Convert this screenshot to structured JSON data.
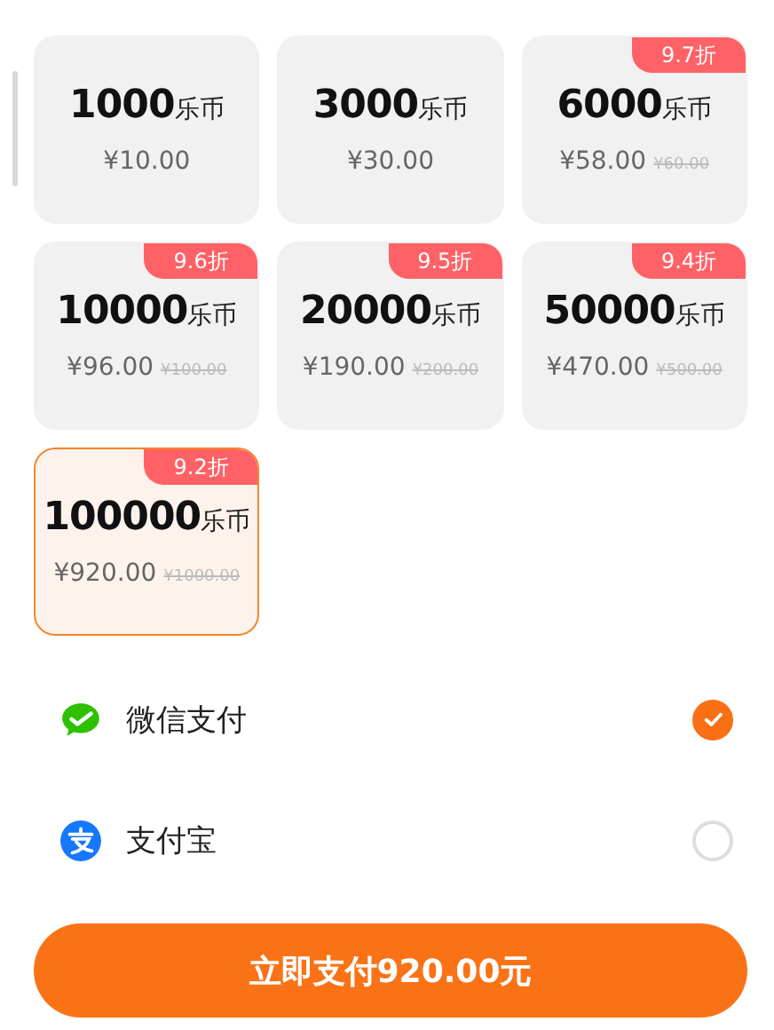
{
  "packages": [
    {
      "amount": "1000",
      "unit": "乐币",
      "price": "¥10.00",
      "selected": false
    },
    {
      "amount": "3000",
      "unit": "乐币",
      "price": "¥30.00",
      "selected": false
    },
    {
      "amount": "6000",
      "unit": "乐币",
      "price": "¥58.00",
      "original_price": "¥60.00",
      "discount": "9.7折",
      "selected": false
    },
    {
      "amount": "10000",
      "unit": "乐币",
      "price": "¥96.00",
      "original_price": "¥100.00",
      "discount": "9.6折",
      "selected": false
    },
    {
      "amount": "20000",
      "unit": "乐币",
      "price": "¥190.00",
      "original_price": "¥200.00",
      "discount": "9.5折",
      "selected": false
    },
    {
      "amount": "50000",
      "unit": "乐币",
      "price": "¥470.00",
      "original_price": "¥500.00",
      "discount": "9.4折",
      "selected": false
    },
    {
      "amount": "100000",
      "unit": "乐币",
      "price": "¥920.00",
      "original_price": "¥1000.00",
      "discount": "9.2折",
      "selected": true
    }
  ],
  "payment_methods": [
    {
      "kind": "wechat",
      "name": "微信支付",
      "selected": true
    },
    {
      "kind": "alipay",
      "name": "支付宝",
      "selected": false
    }
  ],
  "pay_button": {
    "label": "立即支付920.00元"
  }
}
